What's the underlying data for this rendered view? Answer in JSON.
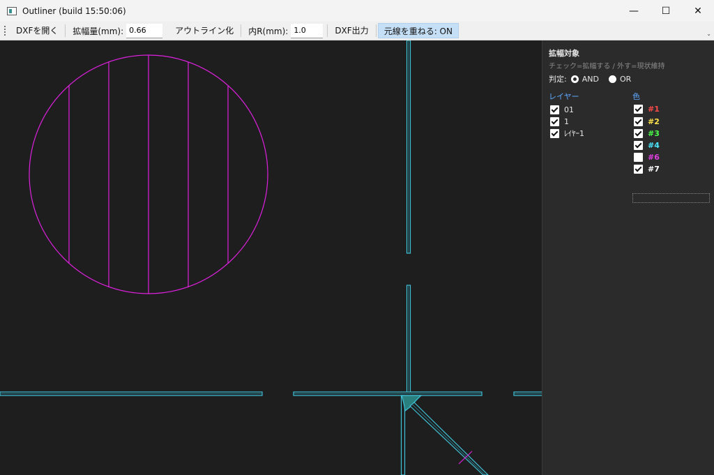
{
  "window": {
    "title": "Outliner  (build 15:50:06)",
    "minimize_glyph": "—",
    "maximize_glyph": "☐",
    "close_glyph": "✕"
  },
  "toolbar": {
    "open_dxf": "DXFを開く",
    "expand_label": "拡幅量(mm):",
    "expand_value": "0.66",
    "outline": "アウトライン化",
    "inner_r_label": "内R(mm):",
    "inner_r_value": "1.0",
    "export_dxf": "DXF出力",
    "overlay": "元線を重ねる: ON",
    "overflow_glyph": "⌄"
  },
  "panel": {
    "title": "拡幅対象",
    "hint": "チェック=拡幅する / 外す=現状維持",
    "judge_label": "判定:",
    "judge_and": "AND",
    "judge_or": "OR",
    "layers_header": "レイヤー",
    "colors_header": "色",
    "layers": [
      {
        "label": "01",
        "checked": true
      },
      {
        "label": "1",
        "checked": true
      },
      {
        "label": "ﾚｲﾔｰ1",
        "checked": true
      }
    ],
    "colors": [
      {
        "label": "#1",
        "checked": true,
        "color": "#ff4a4a"
      },
      {
        "label": "#2",
        "checked": true,
        "color": "#ffe14a"
      },
      {
        "label": "#3",
        "checked": true,
        "color": "#4aff4a"
      },
      {
        "label": "#4",
        "checked": true,
        "color": "#4ae6ff"
      },
      {
        "label": "#6",
        "checked": false,
        "color": "#e040e0"
      },
      {
        "label": "#7",
        "checked": true,
        "color": "#ffffff"
      }
    ]
  },
  "colors": {
    "outline_cyan": "#3fc3d9",
    "magenta": "#e020e0",
    "fill_teal": "#2a7f7f"
  }
}
